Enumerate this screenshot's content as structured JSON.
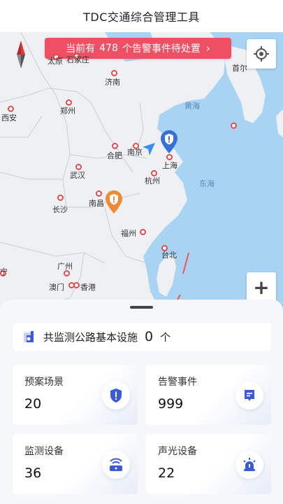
{
  "header": {
    "title": "TDC交通综合管理工具"
  },
  "map": {
    "alert_banner": {
      "prefix": "当前有",
      "count": "478",
      "suffix": "个告警事件待处置",
      "arrow": "›"
    },
    "cities": [
      {
        "name": "太原"
      },
      {
        "name": "石家庄"
      },
      {
        "name": "济南"
      },
      {
        "name": "西安"
      },
      {
        "name": "郑州"
      },
      {
        "name": "合肥"
      },
      {
        "name": "南京"
      },
      {
        "name": "上海"
      },
      {
        "name": "武汉"
      },
      {
        "name": "杭州"
      },
      {
        "name": "长沙"
      },
      {
        "name": "南昌"
      },
      {
        "name": "福州"
      },
      {
        "name": "台北"
      },
      {
        "name": "广州"
      },
      {
        "name": "澳门"
      },
      {
        "name": "香港"
      },
      {
        "name": "首尔"
      },
      {
        "name": "宁"
      }
    ],
    "seas": {
      "yellow_sea": "黄海",
      "east_sea": "东海"
    },
    "zoom_in": "+"
  },
  "panel": {
    "summary": {
      "label": "共监测公路基本设施",
      "count": "0",
      "unit": "个"
    },
    "cards": [
      {
        "label": "预案场景",
        "value": "20",
        "icon": "shield-alert-icon"
      },
      {
        "label": "告警事件",
        "value": "999",
        "icon": "alert-note-icon"
      },
      {
        "label": "监测设备",
        "value": "36",
        "icon": "sensor-device-icon"
      },
      {
        "label": "声光设备",
        "value": "22",
        "icon": "siren-light-icon"
      }
    ]
  },
  "colors": {
    "accent_red": "#ef4f63",
    "marker_blue": "#3a6fd8",
    "marker_orange": "#f08a35",
    "sea": "#a9d3f2",
    "land": "#eef0f4",
    "icon_blue": "#3b5bd6"
  }
}
